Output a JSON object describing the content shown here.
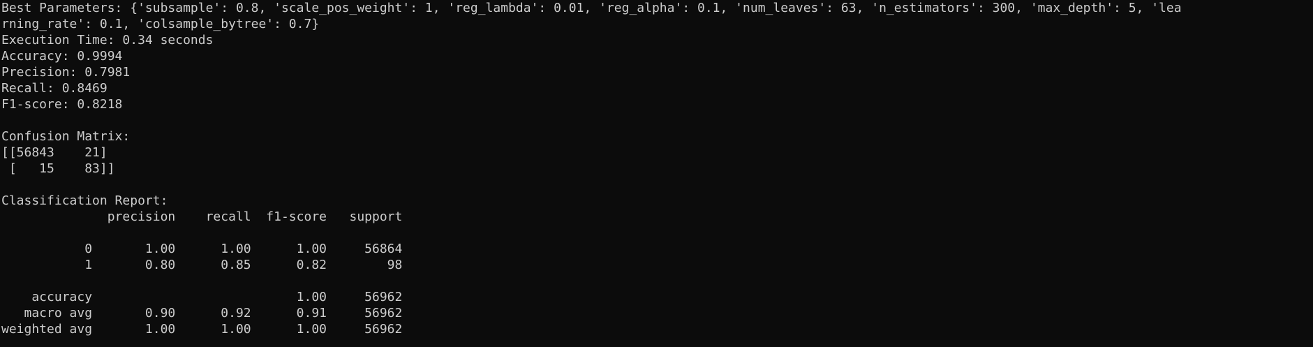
{
  "terminal": {
    "lines": [
      "Best Parameters: {'subsample': 0.8, 'scale_pos_weight': 1, 'reg_lambda': 0.01, 'reg_alpha': 0.1, 'num_leaves': 63, 'n_estimators': 300, 'max_depth': 5, 'lea",
      "rning_rate': 0.1, 'colsample_bytree': 0.7}",
      "Execution Time: 0.34 seconds",
      "Accuracy: 0.9994",
      "Precision: 0.7981",
      "Recall: 0.8469",
      "F1-score: 0.8218",
      "",
      "Confusion Matrix:",
      "[[56843    21]",
      " [   15    83]]",
      "",
      "Classification Report:",
      "              precision    recall  f1-score   support",
      "",
      "           0       1.00      1.00      1.00     56864",
      "           1       0.80      0.85      0.82        98",
      "",
      "    accuracy                           1.00     56962",
      "   macro avg       0.90      0.92      0.91     56962",
      "weighted avg       1.00      1.00      1.00     56962"
    ]
  }
}
